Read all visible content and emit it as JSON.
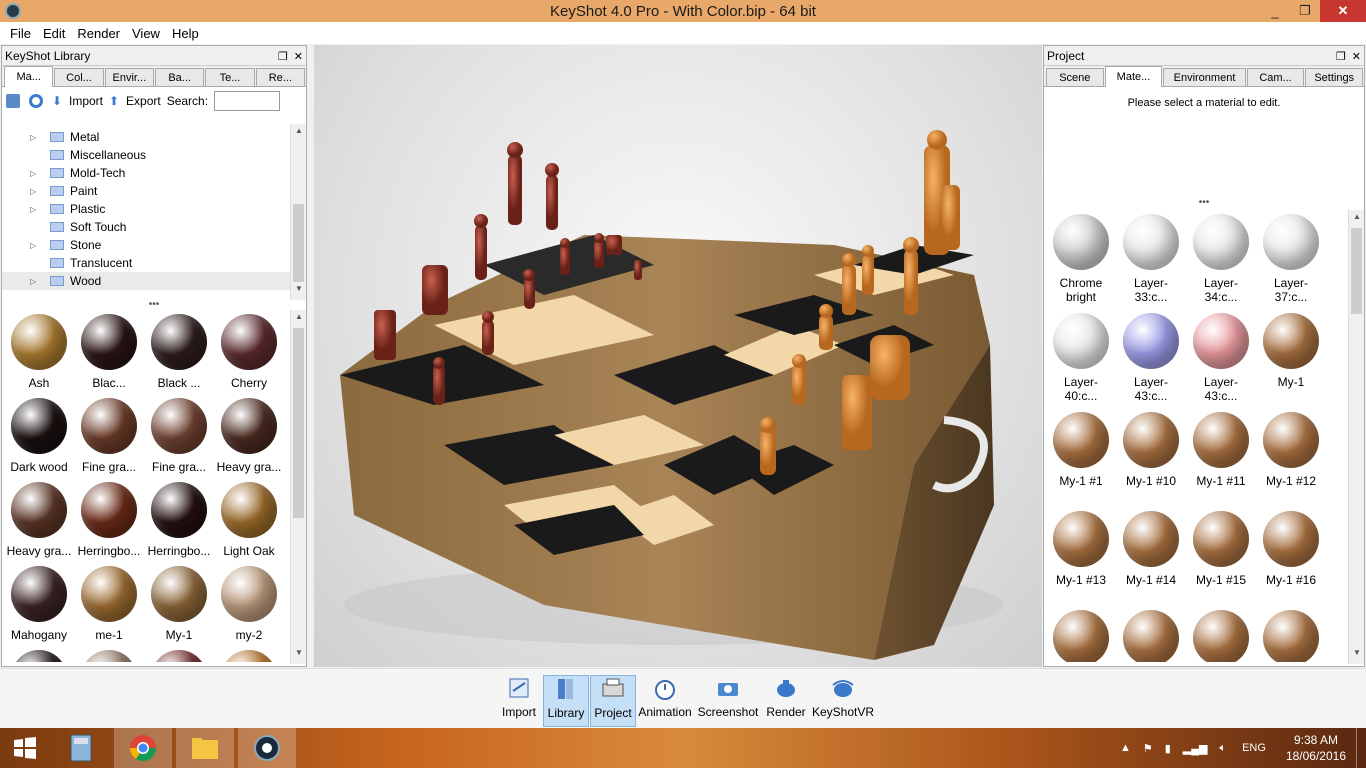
{
  "window": {
    "title": "KeyShot 4.0 Pro  - With Color.bip  - 64 bit",
    "minimize": "_",
    "maximize": "❐",
    "close": "✕"
  },
  "menu": [
    "File",
    "Edit",
    "Render",
    "View",
    "Help"
  ],
  "library": {
    "title": "KeyShot Library",
    "tabs": [
      "Ma...",
      "Col...",
      "Envir...",
      "Ba...",
      "Te...",
      "Re..."
    ],
    "active_tab": 0,
    "toolbar": {
      "import": "Import",
      "export": "Export",
      "search_label": "Search:",
      "search_value": ""
    },
    "tree": [
      {
        "label": "Metal",
        "expandable": true
      },
      {
        "label": "Miscellaneous",
        "expandable": false
      },
      {
        "label": "Mold-Tech",
        "expandable": true
      },
      {
        "label": "Paint",
        "expandable": true
      },
      {
        "label": "Plastic",
        "expandable": true
      },
      {
        "label": "Soft Touch",
        "expandable": false
      },
      {
        "label": "Stone",
        "expandable": true
      },
      {
        "label": "Translucent",
        "expandable": false
      },
      {
        "label": "Wood",
        "expandable": true,
        "selected": true
      }
    ],
    "swatches": [
      {
        "label": "Ash",
        "color": "#a8792e"
      },
      {
        "label": "Blac...",
        "color": "#2a1414"
      },
      {
        "label": "Black ...",
        "color": "#2e1c1c"
      },
      {
        "label": "Cherry",
        "color": "#5a2a2e"
      },
      {
        "label": "Dark wood",
        "color": "#1a1010"
      },
      {
        "label": "Fine gra...",
        "color": "#6a3a28"
      },
      {
        "label": "Fine gra...",
        "color": "#6e4030"
      },
      {
        "label": "Heavy gra...",
        "color": "#4a2a20"
      },
      {
        "label": "Heavy gra...",
        "color": "#5a3426"
      },
      {
        "label": "Herringbo...",
        "color": "#6a2a18"
      },
      {
        "label": "Herringbo...",
        "color": "#241010"
      },
      {
        "label": "Light Oak",
        "color": "#9a6a2a"
      },
      {
        "label": "Mahogany",
        "color": "#3a2222"
      },
      {
        "label": "me-1",
        "color": "#9a6a30"
      },
      {
        "label": "My-1",
        "color": "#8a6438"
      },
      {
        "label": "my-2",
        "color": "#b8987a"
      },
      {
        "label": "",
        "color": "#1a1010"
      },
      {
        "label": "",
        "color": "#8a7060"
      },
      {
        "label": "",
        "color": "#6a2020"
      },
      {
        "label": "",
        "color": "#b06a20"
      }
    ]
  },
  "project": {
    "title": "Project",
    "tabs": [
      "Scene",
      "Mate...",
      "Environment",
      "Cam...",
      "Settings"
    ],
    "active_tab": 1,
    "message": "Please select a material to edit.",
    "materials": [
      {
        "label": "Chrome bright",
        "color": "#d0d0d0"
      },
      {
        "label": "Layer-33:c...",
        "color": "#e8e8e8"
      },
      {
        "label": "Layer-34:c...",
        "color": "#e8e8e8"
      },
      {
        "label": "Layer-37:c...",
        "color": "#e8e8e8"
      },
      {
        "label": "Layer-40:c...",
        "color": "#e8e8e8"
      },
      {
        "label": "Layer-43:c...",
        "color": "#9c9ce8"
      },
      {
        "label": "Layer-43:c...",
        "color": "#e89a9e"
      },
      {
        "label": "My-1",
        "color": "#a87040"
      },
      {
        "label": "My-1 #1",
        "color": "#a87040"
      },
      {
        "label": "My-1 #10",
        "color": "#a87040"
      },
      {
        "label": "My-1 #11",
        "color": "#a87040"
      },
      {
        "label": "My-1 #12",
        "color": "#a87040"
      },
      {
        "label": "My-1 #13",
        "color": "#a87040"
      },
      {
        "label": "My-1 #14",
        "color": "#a87040"
      },
      {
        "label": "My-1 #15",
        "color": "#a87040"
      },
      {
        "label": "My-1 #16",
        "color": "#a87040"
      },
      {
        "label": "",
        "color": "#a87040"
      },
      {
        "label": "",
        "color": "#a87040"
      },
      {
        "label": "",
        "color": "#a87040"
      },
      {
        "label": "",
        "color": "#a87040"
      }
    ]
  },
  "bottom_toolbar": [
    {
      "label": "Import",
      "active": false
    },
    {
      "label": "Library",
      "active": true
    },
    {
      "label": "Project",
      "active": true
    },
    {
      "label": "Animation",
      "active": false
    },
    {
      "label": "Screenshot",
      "active": false
    },
    {
      "label": "Render",
      "active": false
    },
    {
      "label": "KeyShotVR",
      "active": false
    }
  ],
  "taskbar": {
    "language": "ENG",
    "time": "9:38 AM",
    "date": "18/06/2016"
  }
}
